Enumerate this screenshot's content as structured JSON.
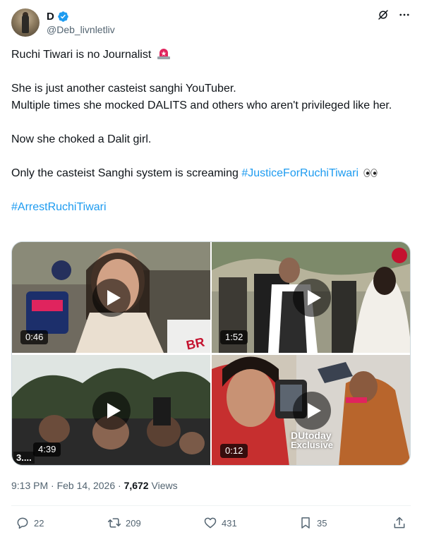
{
  "author": {
    "display_name": "D",
    "handle": "@Deb_livnletliv",
    "verified_color": "#1d9bf0"
  },
  "header_icons": [
    "grok-icon",
    "more-icon"
  ],
  "tweet": {
    "line1": "Ruchi Tiwari is no Journalist",
    "line2": "She is just another casteist sanghi YouTuber.",
    "line3": "Multiple times she mocked DALITS and others who aren't privileged like her.",
    "line4": "Now she choked a Dalit girl.",
    "line5_prefix": "Only the casteist Sanghi system is screaming ",
    "hashtag1": "#JusticeForRuchiTiwari",
    "hashtag2": "#ArrestRuchiTiwari"
  },
  "media": [
    {
      "duration": "0:46",
      "overlay": "BR"
    },
    {
      "duration": "1:52",
      "overlay": ""
    },
    {
      "duration": "4:39",
      "overlay": "3...."
    },
    {
      "duration": "0:12",
      "overlay_line1": "DUtoday",
      "overlay_line2": "Exclusive"
    }
  ],
  "meta": {
    "time": "9:13 PM",
    "sep": "·",
    "date": "Feb 14, 2026",
    "views_count": "7,672",
    "views_label": "Views"
  },
  "actions": {
    "replies": "22",
    "reposts": "209",
    "likes": "431",
    "bookmarks": "35"
  },
  "colors": {
    "link": "#1d9bf0",
    "text": "#0f1419",
    "secondary": "#536471",
    "like_pink": "#f91880"
  }
}
